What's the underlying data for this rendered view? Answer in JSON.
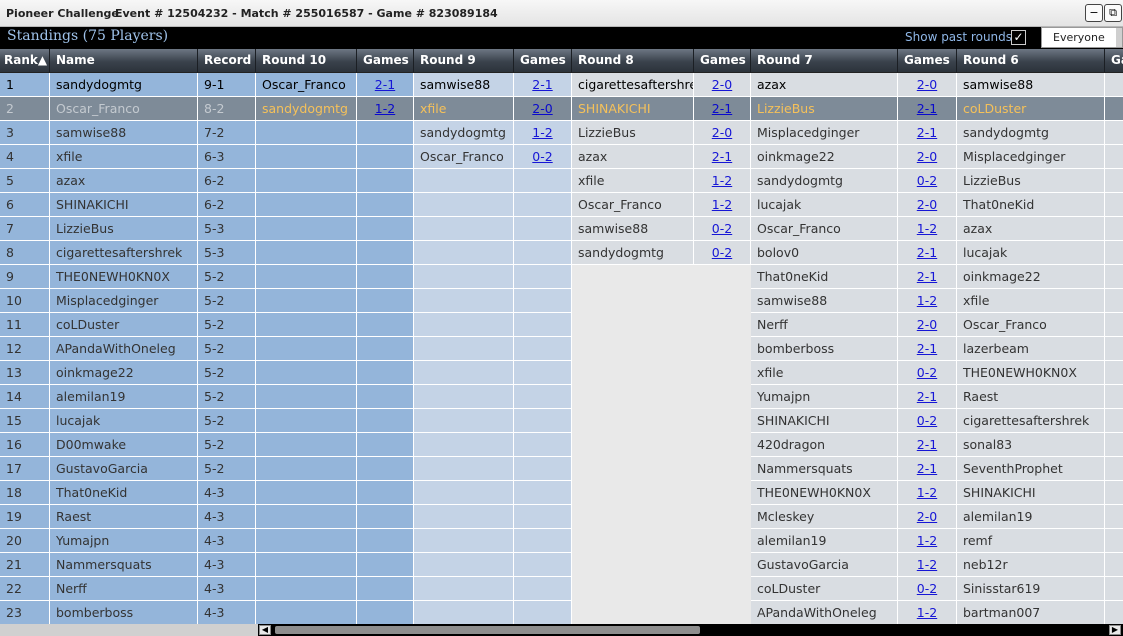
{
  "window": {
    "app_title": "Pioneer Challenge",
    "event_info": "Event # 12504232 - Match # 255016587 - Game # 823089184",
    "minimize_label": "−",
    "restore_label": "⧉"
  },
  "header": {
    "title": "Standings (75 Players)",
    "show_past_label": "Show past rounds",
    "show_past_checked": "✓",
    "filter_value": "Everyone"
  },
  "columns": [
    "Rank▲",
    "Name",
    "Record",
    "Round 10",
    "Games",
    "Round 9",
    "Games",
    "Round 8",
    "Games",
    "Round 7",
    "Games",
    "Round 6",
    "Ga"
  ],
  "rows": [
    {
      "rank": "1",
      "name": "sandydogmtg",
      "record": "9-1",
      "r10": "Oscar_Franco",
      "g10": "2-1",
      "r9": "samwise88",
      "g9": "2-1",
      "r8": "cigarettesaftershrek",
      "g8": "2-0",
      "r7": "azax",
      "g7": "2-0",
      "r6": "samwise88"
    },
    {
      "rank": "2",
      "name": "Oscar_Franco",
      "record": "8-2",
      "r10": "sandydogmtg",
      "g10": "1-2",
      "r9": "xfile",
      "g9": "2-0",
      "r8": "SHINAKICHI",
      "g8": "2-1",
      "r7": "LizzieBus",
      "g7": "2-1",
      "r6": "coLDuster"
    },
    {
      "rank": "3",
      "name": "samwise88",
      "record": "7-2",
      "r10": "",
      "g10": "",
      "r9": "sandydogmtg",
      "g9": "1-2",
      "r8": "LizzieBus",
      "g8": "2-0",
      "r7": "Misplacedginger",
      "g7": "2-1",
      "r6": "sandydogmtg"
    },
    {
      "rank": "4",
      "name": "xfile",
      "record": "6-3",
      "r10": "",
      "g10": "",
      "r9": "Oscar_Franco",
      "g9": "0-2",
      "r8": "azax",
      "g8": "2-1",
      "r7": "oinkmage22",
      "g7": "2-0",
      "r6": "Misplacedginger"
    },
    {
      "rank": "5",
      "name": "azax",
      "record": "6-2",
      "r10": "",
      "g10": "",
      "r9": "",
      "g9": "",
      "r8": "xfile",
      "g8": "1-2",
      "r7": "sandydogmtg",
      "g7": "0-2",
      "r6": "LizzieBus"
    },
    {
      "rank": "6",
      "name": "SHINAKICHI",
      "record": "6-2",
      "r10": "",
      "g10": "",
      "r9": "",
      "g9": "",
      "r8": "Oscar_Franco",
      "g8": "1-2",
      "r7": "lucajak",
      "g7": "2-0",
      "r6": "That0neKid"
    },
    {
      "rank": "7",
      "name": "LizzieBus",
      "record": "5-3",
      "r10": "",
      "g10": "",
      "r9": "",
      "g9": "",
      "r8": "samwise88",
      "g8": "0-2",
      "r7": "Oscar_Franco",
      "g7": "1-2",
      "r6": "azax"
    },
    {
      "rank": "8",
      "name": "cigarettesaftershrek",
      "record": "5-3",
      "r10": "",
      "g10": "",
      "r9": "",
      "g9": "",
      "r8": "sandydogmtg",
      "g8": "0-2",
      "r7": "bolov0",
      "g7": "2-1",
      "r6": "lucajak"
    },
    {
      "rank": "9",
      "name": "THE0NEWH0KN0X",
      "record": "5-2",
      "r10": "",
      "g10": "",
      "r9": "",
      "g9": "",
      "r8": "",
      "g8": "",
      "r7": "That0neKid",
      "g7": "2-1",
      "r6": "oinkmage22"
    },
    {
      "rank": "10",
      "name": "Misplacedginger",
      "record": "5-2",
      "r10": "",
      "g10": "",
      "r9": "",
      "g9": "",
      "r8": "",
      "g8": "",
      "r7": "samwise88",
      "g7": "1-2",
      "r6": "xfile"
    },
    {
      "rank": "11",
      "name": "coLDuster",
      "record": "5-2",
      "r10": "",
      "g10": "",
      "r9": "",
      "g9": "",
      "r8": "",
      "g8": "",
      "r7": "Nerff",
      "g7": "2-0",
      "r6": "Oscar_Franco"
    },
    {
      "rank": "12",
      "name": "APandaWithOneleg",
      "record": "5-2",
      "r10": "",
      "g10": "",
      "r9": "",
      "g9": "",
      "r8": "",
      "g8": "",
      "r7": "bomberboss",
      "g7": "2-1",
      "r6": "lazerbeam"
    },
    {
      "rank": "13",
      "name": "oinkmage22",
      "record": "5-2",
      "r10": "",
      "g10": "",
      "r9": "",
      "g9": "",
      "r8": "",
      "g8": "",
      "r7": "xfile",
      "g7": "0-2",
      "r6": "THE0NEWH0KN0X"
    },
    {
      "rank": "14",
      "name": "alemilan19",
      "record": "5-2",
      "r10": "",
      "g10": "",
      "r9": "",
      "g9": "",
      "r8": "",
      "g8": "",
      "r7": "Yumajpn",
      "g7": "2-1",
      "r6": "Raest"
    },
    {
      "rank": "15",
      "name": "lucajak",
      "record": "5-2",
      "r10": "",
      "g10": "",
      "r9": "",
      "g9": "",
      "r8": "",
      "g8": "",
      "r7": "SHINAKICHI",
      "g7": "0-2",
      "r6": "cigarettesaftershrek"
    },
    {
      "rank": "16",
      "name": "D00mwake",
      "record": "5-2",
      "r10": "",
      "g10": "",
      "r9": "",
      "g9": "",
      "r8": "",
      "g8": "",
      "r7": "420dragon",
      "g7": "2-1",
      "r6": "sonal83"
    },
    {
      "rank": "17",
      "name": "GustavoGarcia",
      "record": "5-2",
      "r10": "",
      "g10": "",
      "r9": "",
      "g9": "",
      "r8": "",
      "g8": "",
      "r7": "Nammersquats",
      "g7": "2-1",
      "r6": "SeventhProphet"
    },
    {
      "rank": "18",
      "name": "That0neKid",
      "record": "4-3",
      "r10": "",
      "g10": "",
      "r9": "",
      "g9": "",
      "r8": "",
      "g8": "",
      "r7": "THE0NEWH0KN0X",
      "g7": "1-2",
      "r6": "SHINAKICHI"
    },
    {
      "rank": "19",
      "name": "Raest",
      "record": "4-3",
      "r10": "",
      "g10": "",
      "r9": "",
      "g9": "",
      "r8": "",
      "g8": "",
      "r7": "Mcleskey",
      "g7": "2-0",
      "r6": "alemilan19"
    },
    {
      "rank": "20",
      "name": "Yumajpn",
      "record": "4-3",
      "r10": "",
      "g10": "",
      "r9": "",
      "g9": "",
      "r8": "",
      "g8": "",
      "r7": "alemilan19",
      "g7": "1-2",
      "r6": "remf"
    },
    {
      "rank": "21",
      "name": "Nammersquats",
      "record": "4-3",
      "r10": "",
      "g10": "",
      "r9": "",
      "g9": "",
      "r8": "",
      "g8": "",
      "r7": "GustavoGarcia",
      "g7": "1-2",
      "r6": "neb12r"
    },
    {
      "rank": "22",
      "name": "Nerff",
      "record": "4-3",
      "r10": "",
      "g10": "",
      "r9": "",
      "g9": "",
      "r8": "",
      "g8": "",
      "r7": "coLDuster",
      "g7": "0-2",
      "r6": "Sinisstar619"
    },
    {
      "rank": "23",
      "name": "bomberboss",
      "record": "4-3",
      "r10": "",
      "g10": "",
      "r9": "",
      "g9": "",
      "r8": "",
      "g8": "",
      "r7": "APandaWithOneleg",
      "g7": "1-2",
      "r6": "bartman007"
    }
  ],
  "scrollbar": {
    "left_arrow": "◀",
    "right_arrow": "▶"
  }
}
